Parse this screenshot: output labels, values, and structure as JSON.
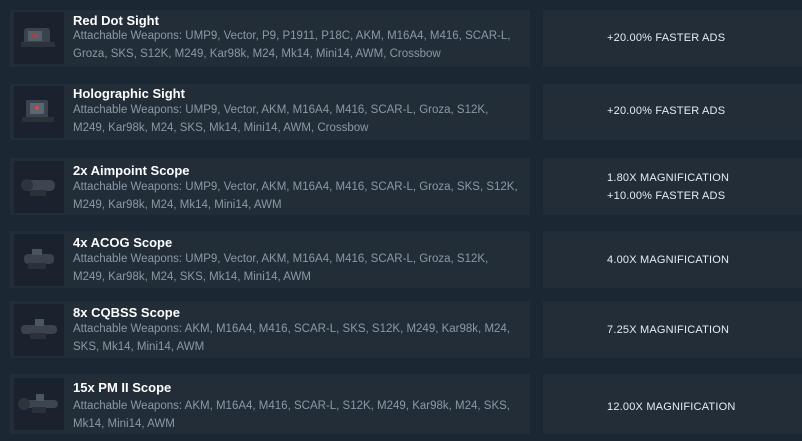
{
  "attachments": [
    {
      "name": "Red Dot Sight",
      "weapons": "Attachable Weapons: UMP9, Vector, P9, P1911, P18C, AKM, M16A4, M416, SCAR-L, Groza, SKS, S12K, M249, Kar98k, M24, Mk14, Mini14, AWM, Crossbow",
      "stats": [
        "+20.00% FASTER ADS"
      ]
    },
    {
      "name": "Holographic Sight",
      "weapons": "Attachable Weapons: UMP9, Vector, AKM, M16A4, M416, SCAR-L, Groza, S12K, M249, Kar98k, M24, SKS, Mk14, Mini14, AWM, Crossbow",
      "stats": [
        "+20.00% FASTER ADS"
      ]
    },
    {
      "name": "2x Aimpoint Scope",
      "weapons": "Attachable Weapons: UMP9, Vector, AKM, M16A4, M416, SCAR-L, Groza, SKS, S12K, M249, Kar98k, M24, Mk14, Mini14, AWM",
      "stats": [
        "1.80X MAGNIFICATION",
        "+10.00% FASTER ADS"
      ]
    },
    {
      "name": "4x ACOG Scope",
      "weapons": "Attachable Weapons: UMP9, Vector, AKM, M16A4, M416, SCAR-L, Groza, S12K, M249, Kar98k, M24, SKS, Mk14, Mini14, AWM",
      "stats": [
        "4.00X MAGNIFICATION"
      ]
    },
    {
      "name": "8x CQBSS Scope",
      "weapons": "Attachable Weapons: AKM, M16A4, M416, SCAR-L, SKS, S12K, M249, Kar98k, M24, SKS, Mk14, Mini14, AWM",
      "stats": [
        "7.25X MAGNIFICATION"
      ]
    },
    {
      "name": "15x PM II Scope",
      "weapons": "Attachable Weapons: AKM, M16A4, M416, SCAR-L, S12K, M249, Kar98k, M24, SKS, Mk14, Mini14, AWM",
      "stats": [
        "12.00X MAGNIFICATION"
      ]
    }
  ]
}
